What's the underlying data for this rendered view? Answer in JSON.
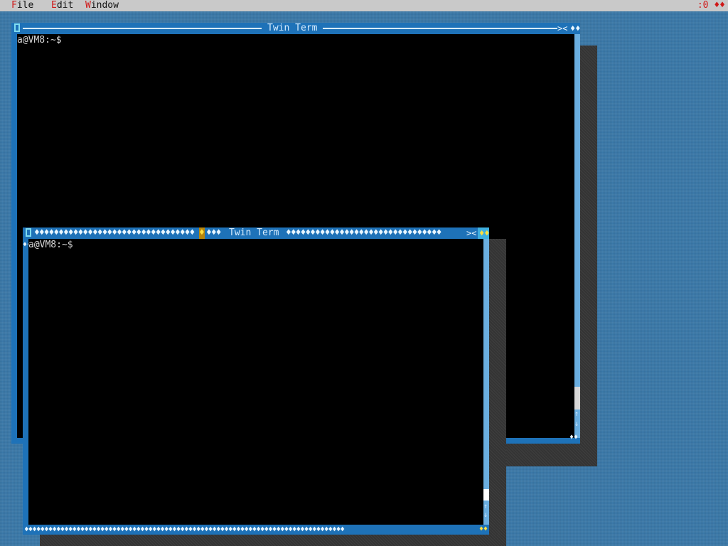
{
  "menubar": {
    "items": [
      {
        "hotkey": "F",
        "rest": "ile"
      },
      {
        "hotkey": "E",
        "rest": "dit"
      },
      {
        "hotkey": "W",
        "rest": "indow"
      }
    ],
    "right_indicator": ":0 ♦♦"
  },
  "windows": [
    {
      "title": "Twin Term",
      "prompt": "a@VM8:~$",
      "active": false
    },
    {
      "title": "Twin Term",
      "prompt": "a@VM8:~$",
      "active": true
    }
  ],
  "glyphs": {
    "close_box": "[]",
    "control_buttons": "><",
    "diamond": "♦",
    "scroll_up": "↑",
    "scroll_down": "↓"
  },
  "colors": {
    "desktop": "#3a78a8",
    "menubar": "#c9c9c9",
    "hotkey": "#d01818",
    "titlebar": "#1e72b8",
    "title_text": "#d6ecff",
    "terminal_bg": "#000000",
    "terminal_fg": "#d8d8d8",
    "focus_marker": "#ffe040"
  }
}
